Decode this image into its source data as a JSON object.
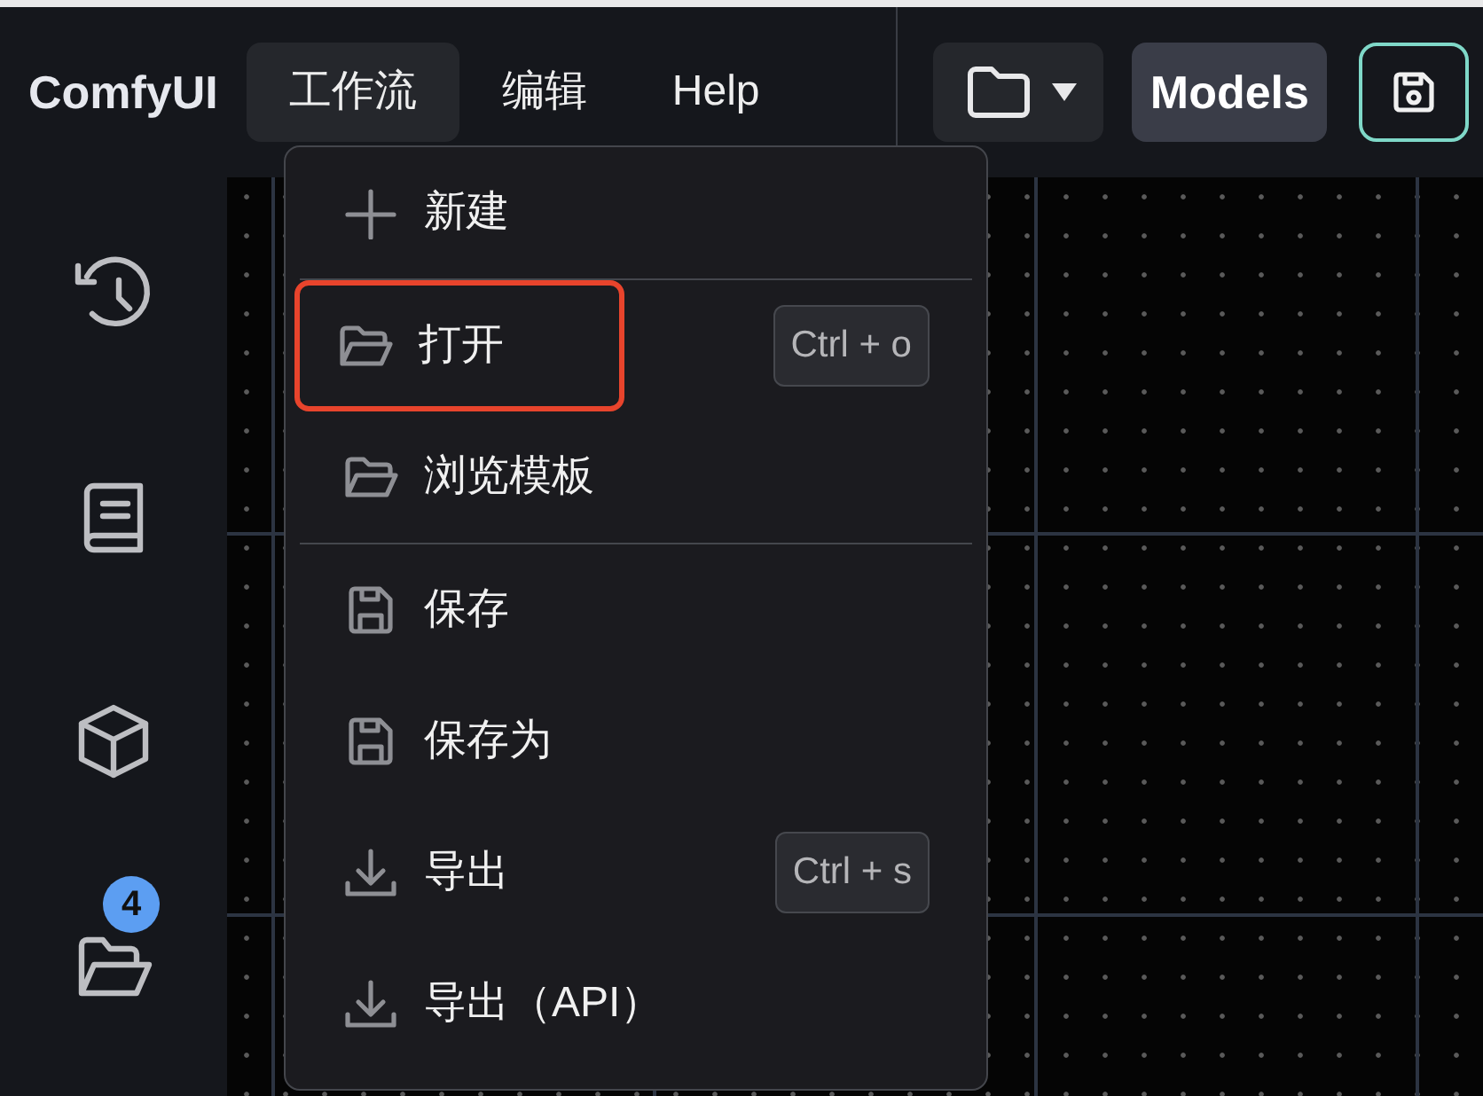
{
  "header": {
    "logo": "ComfyUI",
    "menus": [
      {
        "label": "工作流",
        "selected": true
      },
      {
        "label": "编辑",
        "selected": false
      },
      {
        "label": "Help",
        "selected": false
      }
    ],
    "models_button": "Models"
  },
  "sidebar": {
    "folder_badge": "4"
  },
  "menu": {
    "groups": [
      [
        {
          "label": "新建",
          "highlighted": false
        }
      ],
      [
        {
          "label": "打开",
          "shortcut": "Ctrl + o",
          "highlighted": true
        },
        {
          "label": "浏览模板",
          "highlighted": false
        }
      ],
      [
        {
          "label": "保存",
          "highlighted": false
        },
        {
          "label": "保存为",
          "highlighted": false
        },
        {
          "label": "导出",
          "shortcut": "Ctrl + s",
          "highlighted": false
        },
        {
          "label": "导出（API）",
          "highlighted": false
        }
      ]
    ]
  }
}
